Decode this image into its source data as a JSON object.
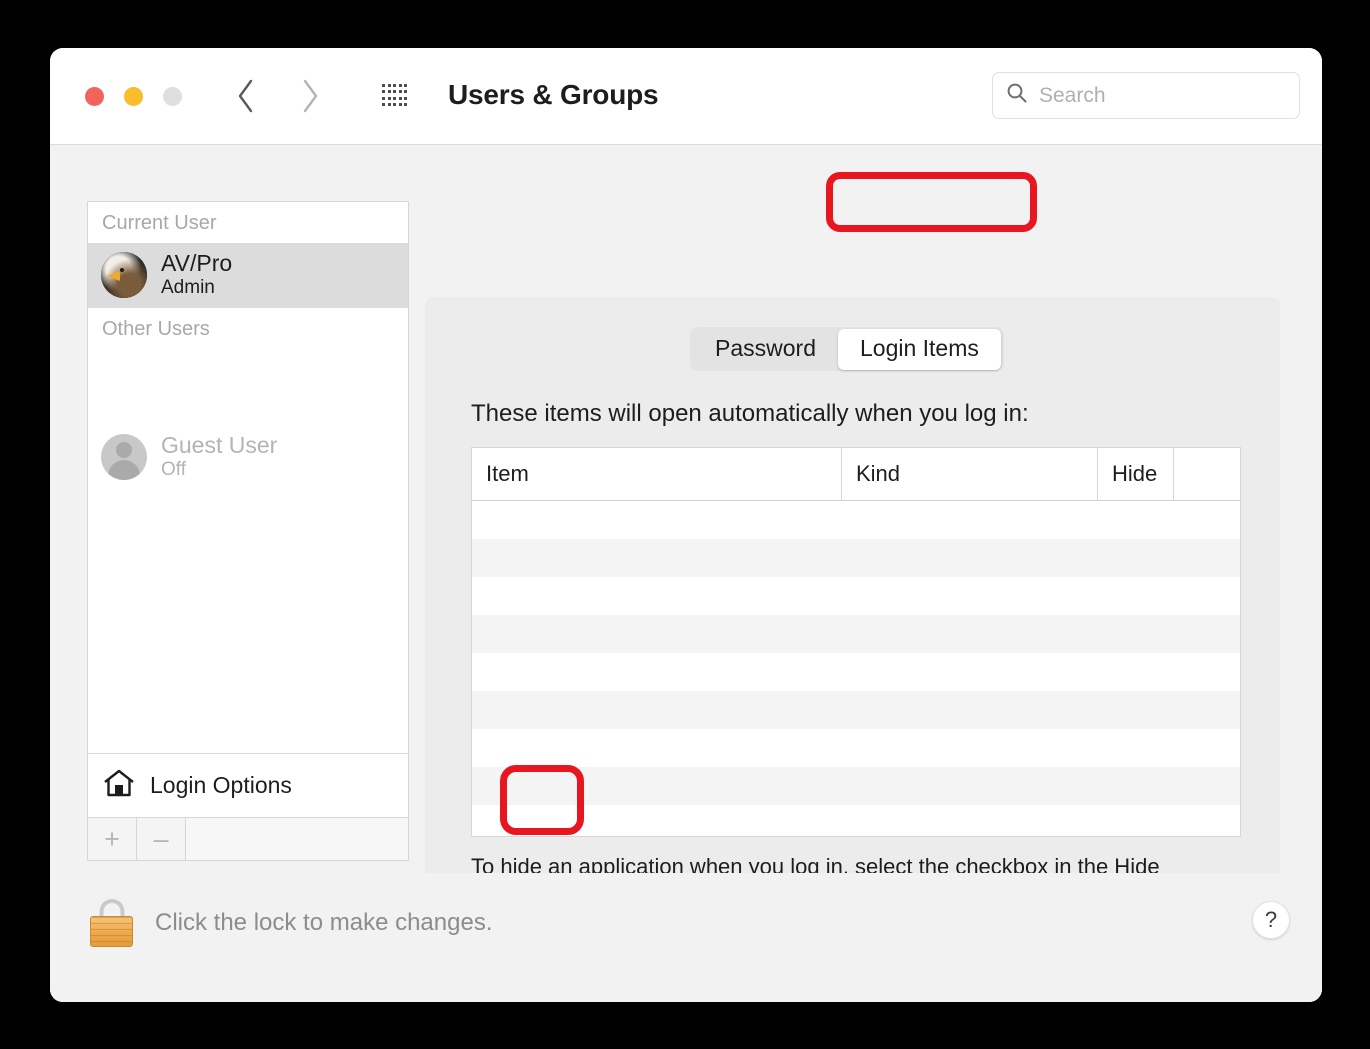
{
  "window": {
    "title": "Users & Groups",
    "traffic_lights": [
      "close-red",
      "minimize-yellow",
      "zoom-gray-disabled"
    ],
    "back_label": "‹",
    "forward_label": "›",
    "grid_icon": "show-all-grid-icon"
  },
  "search": {
    "placeholder": "Search",
    "value": "",
    "icon": "search-icon"
  },
  "sidebar": {
    "groups": [
      {
        "header": "Current User",
        "users": [
          {
            "name": "AV/Pro",
            "role": "Admin",
            "selected": true,
            "avatar": "eagle-photo-avatar"
          }
        ]
      },
      {
        "header": "Other Users",
        "users": [
          {
            "name": "Guest User",
            "role": "Off",
            "selected": false,
            "avatar": "generic-person-avatar"
          }
        ]
      }
    ],
    "login_options": {
      "label": "Login Options",
      "icon": "home-icon"
    },
    "footer": {
      "add_label": "+",
      "remove_label": "–"
    }
  },
  "content": {
    "tabs": [
      {
        "label": "Password",
        "active": false
      },
      {
        "label": "Login Items",
        "active": true
      }
    ],
    "heading": "These items will open automatically when you log in:",
    "table": {
      "columns": [
        "Item",
        "Kind",
        "Hide",
        ""
      ],
      "rows": [],
      "empty_row_count": 9
    },
    "note": "To hide an application when you log in, select the checkbox in the Hide column next to the application.",
    "add_remove": {
      "add_label": "+",
      "remove_label": "–"
    }
  },
  "bottom": {
    "lock_text": "Click the lock to make changes.",
    "lock_icon": "closed-padlock-icon",
    "help_label": "?"
  },
  "annotations": {
    "accent_color": "#e8171f",
    "highlight_tab": "Login Items",
    "highlight_button": "remove-minus-button"
  }
}
